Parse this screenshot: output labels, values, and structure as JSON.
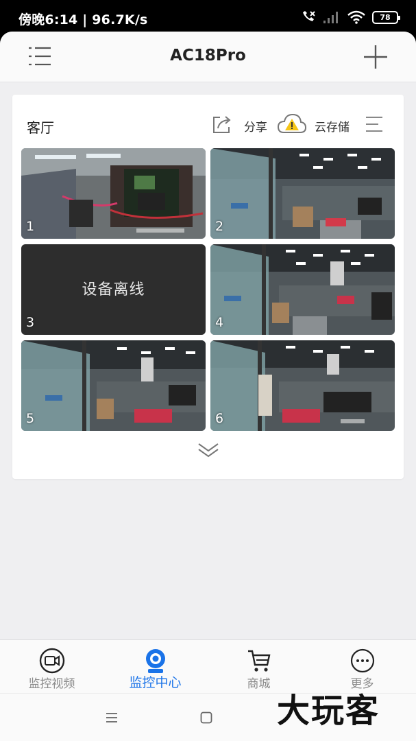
{
  "status_bar": {
    "time_speed": "傍晚6:14 | 96.7K/s",
    "battery": "78",
    "icons": [
      "call-missed-icon",
      "signal-icon",
      "wifi-icon",
      "battery-icon"
    ]
  },
  "header": {
    "title": "AC18Pro",
    "menu_icon": "list-menu-icon",
    "add_icon": "plus-icon"
  },
  "group": {
    "title": "客厅",
    "share_label": "分享",
    "cloud_label": "云存储",
    "more_icon": "list-icon"
  },
  "cameras": [
    {
      "number": "1",
      "status": "online",
      "scene": "circuit board close-up"
    },
    {
      "number": "2",
      "status": "online",
      "scene": "office"
    },
    {
      "number": "3",
      "status": "offline",
      "offline_text": "设备离线"
    },
    {
      "number": "4",
      "status": "online",
      "scene": "office"
    },
    {
      "number": "5",
      "status": "online",
      "scene": "office"
    },
    {
      "number": "6",
      "status": "online",
      "scene": "office"
    }
  ],
  "tabs": [
    {
      "label": "监控视频",
      "icon": "video-camera-icon",
      "active": false
    },
    {
      "label": "监控中心",
      "icon": "webcam-icon",
      "active": true
    },
    {
      "label": "商城",
      "icon": "cart-icon",
      "active": false
    },
    {
      "label": "更多",
      "icon": "more-dots-icon",
      "active": false
    }
  ],
  "watermark": "大玩客",
  "colors": {
    "accent": "#1a73e8",
    "warning": "#f5c518"
  }
}
